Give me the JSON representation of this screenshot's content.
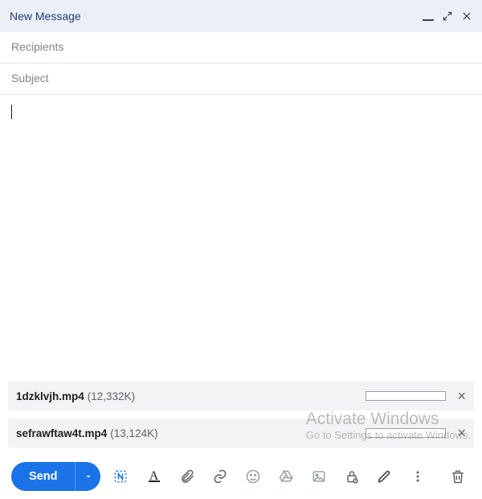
{
  "header": {
    "title": "New Message"
  },
  "fields": {
    "recipients_placeholder": "Recipients",
    "recipients_value": "",
    "subject_placeholder": "Subject",
    "subject_value": ""
  },
  "body_text": "",
  "attachments": [
    {
      "filename": "1dzklvjh.mp4",
      "size": "(12,332K)"
    },
    {
      "filename": "sefrawftaw4t.mp4",
      "size": "(13,124K)"
    }
  ],
  "toolbar": {
    "send_label": "Send"
  },
  "watermark": {
    "line1": "Activate Windows",
    "line2": "Go to Settings to activate Windows."
  },
  "colors": {
    "accent": "#1a73e8",
    "header_bg": "#eceff7",
    "attach_bg": "#f1f3f4",
    "muted": "#5f6368"
  }
}
